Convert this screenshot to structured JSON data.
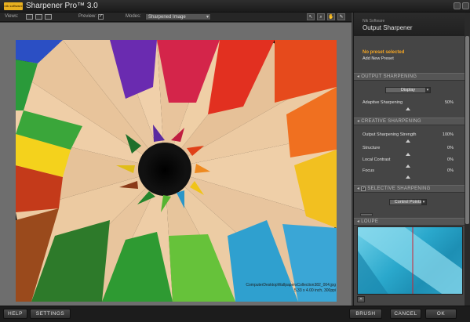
{
  "app": {
    "logo_text": "nik software",
    "title": "Sharpener Pro™ 3.0"
  },
  "toolbar": {
    "views_label": "Views:",
    "preview_label": "Preview:",
    "preview_checked": true,
    "modes_label": "Modes:",
    "mode_value": "Sharpened Image",
    "tools": [
      "zoom-arrow-icon",
      "magnifier-icon",
      "hand-icon",
      "eyedropper-icon"
    ]
  },
  "image": {
    "filename": "ComputerDesktopWallpapersCollection382_004.jpg",
    "dimensions": "5.33 x 4.00 inch, 300ppi"
  },
  "panel": {
    "vendor": "Nik Software",
    "title": "Output Sharpener",
    "preset_status": "No preset selected",
    "add_preset": "Add New Preset",
    "output_sharpening": {
      "header": "OUTPUT SHARPENING",
      "device": "Display",
      "adaptive_label": "Adaptive Sharpening",
      "adaptive_value": "50%"
    },
    "creative_sharpening": {
      "header": "CREATIVE SHARPENING",
      "rows": [
        {
          "label": "Output Sharpening Strength",
          "value": "100%"
        },
        {
          "label": "Structure",
          "value": "0%"
        },
        {
          "label": "Local Contrast",
          "value": "0%"
        },
        {
          "label": "Focus",
          "value": "0%"
        }
      ]
    },
    "selective_sharpening": {
      "header": "SELECTIVE SHARPENING",
      "mode": "Control Points",
      "checked": true
    },
    "loupe": {
      "header": "LOUPE"
    }
  },
  "buttons": {
    "help": "HELP",
    "settings": "SETTINGS",
    "brush": "BRUSH",
    "cancel": "CANCEL",
    "ok": "OK"
  },
  "colors": {
    "accent_orange": "#f5a623",
    "panel_bg": "#454545",
    "preview_bg": "#6e6e6e"
  }
}
